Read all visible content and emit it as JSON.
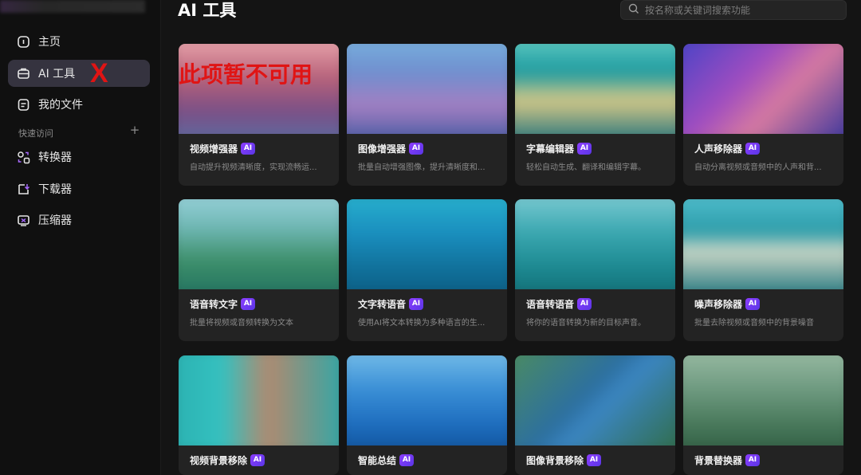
{
  "sidebar": {
    "items": [
      {
        "label": "主页",
        "icon": "home-icon"
      },
      {
        "label": "AI 工具",
        "icon": "toolbox-icon",
        "active": true
      },
      {
        "label": "我的文件",
        "icon": "file-icon"
      }
    ],
    "quick_access": {
      "label": "快速访问",
      "add": "+",
      "items": [
        {
          "label": "转换器",
          "icon": "converter-icon"
        },
        {
          "label": "下载器",
          "icon": "download-icon"
        },
        {
          "label": "压缩器",
          "icon": "compress-icon"
        }
      ]
    },
    "annotation": "X"
  },
  "header": {
    "title": "AI 工具",
    "search_placeholder": "按名称或关键词搜索功能"
  },
  "annotation_unavailable": "此项暂不可用",
  "badge": "AI",
  "cards": [
    {
      "title": "视频增强器",
      "desc": "自动提升视频清晰度，实现流畅运..."
    },
    {
      "title": "图像增强器",
      "desc": "批量自动增强图像，提升清晰度和..."
    },
    {
      "title": "字幕编辑器",
      "desc": "轻松自动生成、翻译和编辑字幕。"
    },
    {
      "title": "人声移除器",
      "desc": "自动分离视频或音频中的人声和背..."
    },
    {
      "title": "语音转文字",
      "desc": "批量将视频或音频转换为文本"
    },
    {
      "title": "文字转语音",
      "desc": "使用AI将文本转换为多种语言的生..."
    },
    {
      "title": "语音转语音",
      "desc": "将你的语音转换为新的目标声音。"
    },
    {
      "title": "噪声移除器",
      "desc": "批量去除视频或音频中的背景噪音"
    },
    {
      "title": "视频背景移除",
      "desc": ""
    },
    {
      "title": "智能总结",
      "desc": ""
    },
    {
      "title": "图像背景移除",
      "desc": ""
    },
    {
      "title": "背景替换器",
      "desc": ""
    }
  ],
  "colors": {
    "accent": "#7b3cff",
    "annotation_red": "#e01414",
    "sidebar_active": "#35333f"
  }
}
